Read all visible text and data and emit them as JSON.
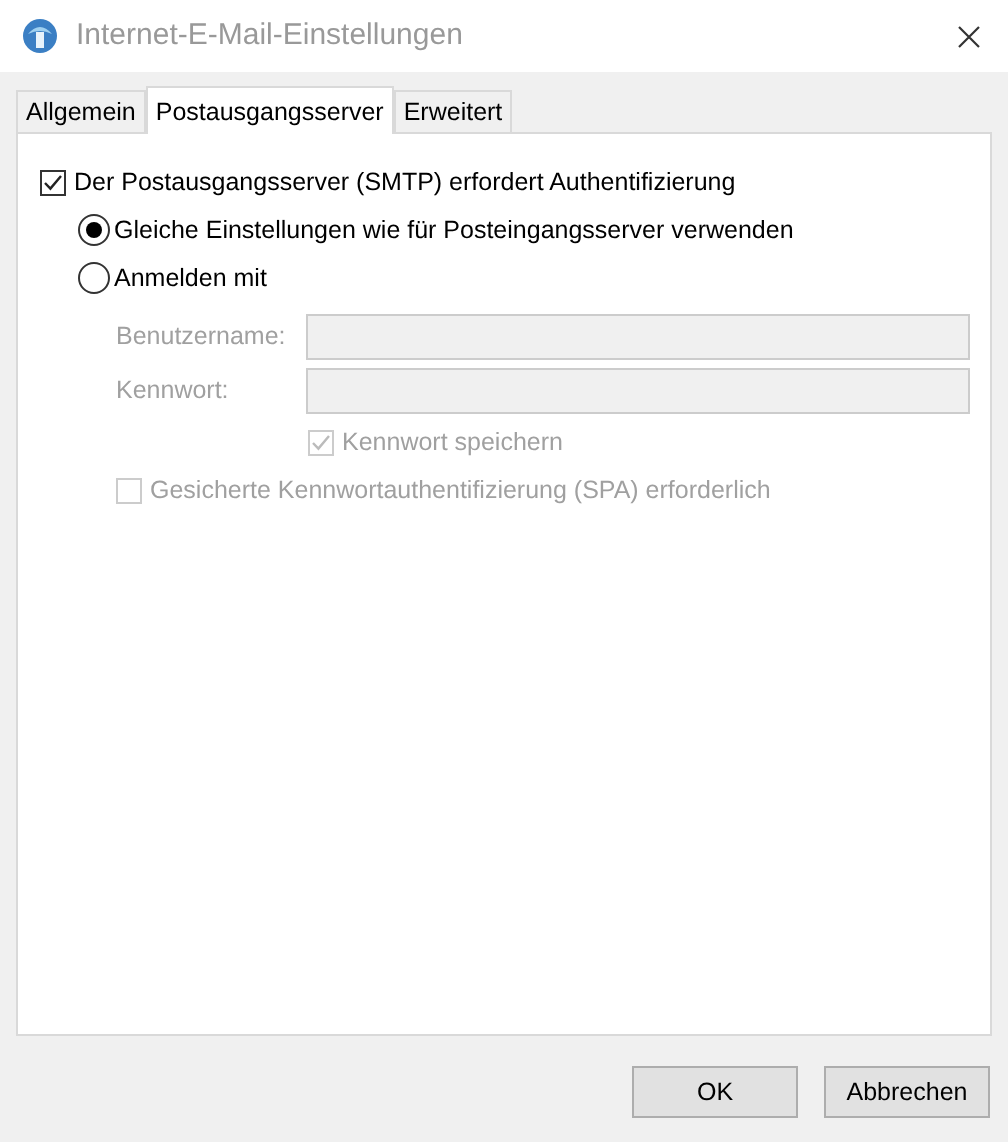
{
  "window": {
    "title": "Internet-E-Mail-Einstellungen"
  },
  "tabs": [
    {
      "label": "Allgemein",
      "selected": false
    },
    {
      "label": "Postausgangsserver",
      "selected": true
    },
    {
      "label": "Erweitert",
      "selected": false
    }
  ],
  "auth_checkbox": {
    "label": "Der Postausgangsserver (SMTP) erfordert Authentifizierung",
    "checked": true
  },
  "login_options": [
    {
      "label": "Gleiche Einstellungen wie für Posteingangsserver verwenden",
      "selected": true
    },
    {
      "label": "Anmelden mit",
      "selected": false
    }
  ],
  "fields": [
    {
      "label": "Benutzername:",
      "disabled": true
    },
    {
      "label": "Kennwort:",
      "disabled": true
    }
  ],
  "save_password": {
    "label": "Kennwort speichern",
    "checked": true,
    "disabled": true
  },
  "spa": {
    "label": "Gesicherte Kennwortauthentifizierung (SPA) erforderlich",
    "checked": false,
    "disabled": true
  },
  "buttons": [
    "OK",
    "Abbrechen"
  ]
}
